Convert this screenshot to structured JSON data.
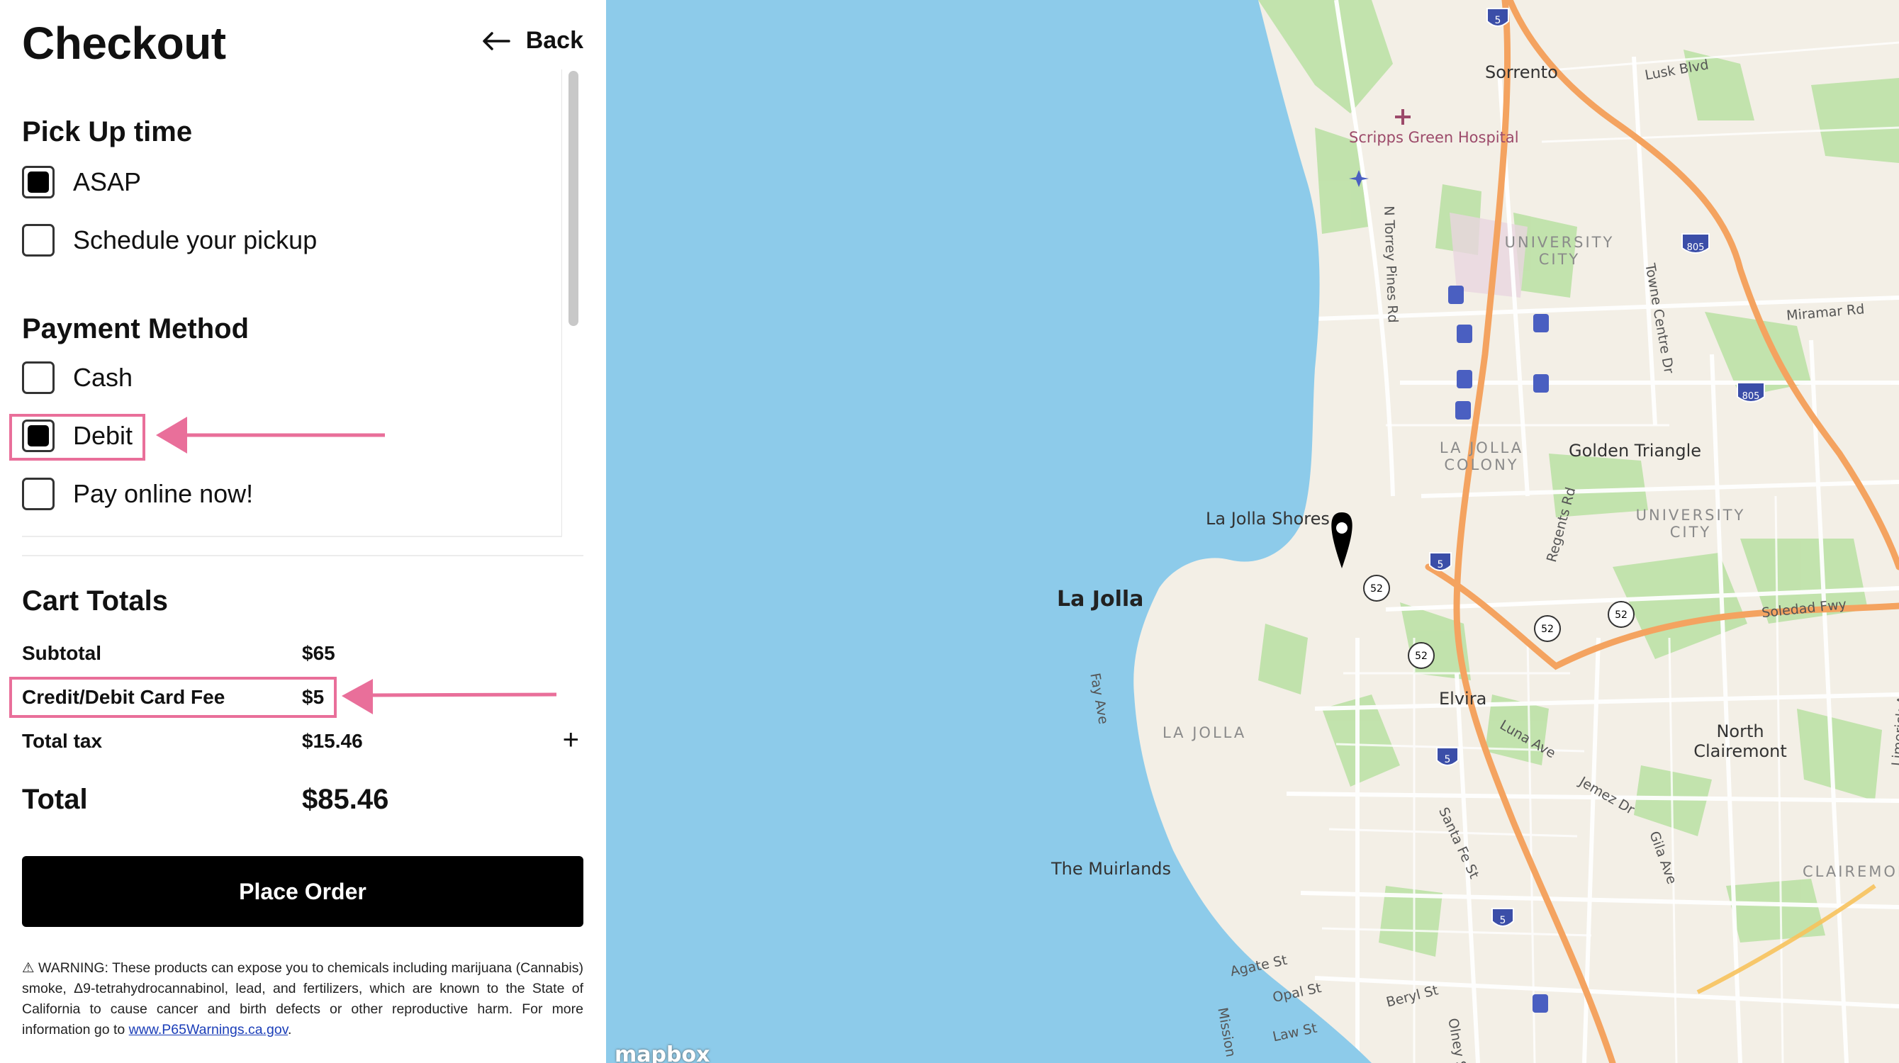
{
  "header": {
    "title": "Checkout",
    "back_label": "Back"
  },
  "pickup": {
    "title": "Pick Up time",
    "options": [
      {
        "label": "ASAP",
        "checked": true
      },
      {
        "label": "Schedule your pickup",
        "checked": false
      }
    ]
  },
  "payment": {
    "title": "Payment Method",
    "options": [
      {
        "label": "Cash",
        "checked": false
      },
      {
        "label": "Debit",
        "checked": true
      },
      {
        "label": "Pay online now!",
        "checked": false
      }
    ]
  },
  "totals": {
    "title": "Cart Totals",
    "subtotal_label": "Subtotal",
    "subtotal_value": "$65",
    "fee_label": "Credit/Debit Card Fee",
    "fee_value": "$5",
    "tax_label": "Total tax",
    "tax_value": "$15.46",
    "total_label": "Total",
    "total_value": "$85.46"
  },
  "place_order_label": "Place Order",
  "warning": {
    "text": "⚠ WARNING: These products can expose you to chemicals including marijuana (Cannabis) smoke, Δ9-tetrahydrocannabinol, lead, and fertilizers, which are known to the State of California to cause cancer and birth defects or other reproductive harm. For more information go to ",
    "link": "www.P65Warnings.ca.gov",
    "tail": "."
  },
  "annotation_color": "#e96f9a",
  "map": {
    "water_color": "#8dcbea",
    "land_color": "#f3efe6",
    "park_color": "#b8e0a0",
    "highway_color": "#f4a360",
    "attribution": "mapbox",
    "labels": {
      "sorrento": "Sorrento",
      "lusk": "Lusk Blvd",
      "scripps": "Scripps Green Hospital",
      "university_city_1": "UNIVERSITY CITY",
      "torrey": "N Torrey Pines Rd",
      "towne": "Towne Centre Dr",
      "miramar": "Miramar Rd",
      "lajolla_colony": "LA JOLLA COLONY",
      "golden": "Golden Triangle",
      "shores": "La Jolla Shores",
      "university_city_2": "UNIVERSITY CITY",
      "lajolla": "La Jolla",
      "regents": "Regents Rd",
      "soledad": "Soledad Fwy",
      "fay": "Fay Ave",
      "elvira": "Elvira",
      "luna": "Luna Ave",
      "lajolla_area": "LA JOLLA",
      "north_clairemont": "North Clairemont",
      "limerick": "Limerick Ave",
      "jemez": "Jemez Dr",
      "gila": "Gila Ave",
      "santa_fe": "Santa Fe St",
      "muirlands": "The Muirlands",
      "clairemont": "CLAIREMONT",
      "agate": "Agate St",
      "opal": "Opal St",
      "beryl": "Beryl St",
      "law": "Law St",
      "olney": "Olney St",
      "mission": "Mission"
    },
    "shields": [
      "5",
      "805",
      "52"
    ]
  }
}
